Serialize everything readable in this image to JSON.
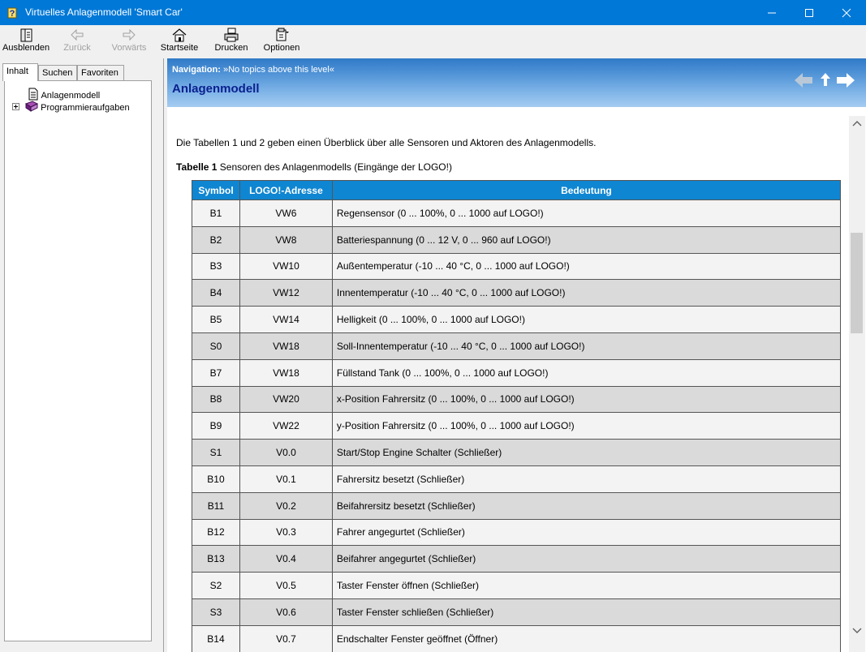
{
  "window": {
    "title": "Virtuelles Anlagenmodell 'Smart Car'",
    "app_icon": "help-question-icon",
    "controls": [
      "minimize-icon",
      "maximize-icon",
      "close-icon"
    ]
  },
  "toolbar": {
    "hide_label": "Ausblenden",
    "back_label": "Zurück",
    "forward_label": "Vorwärts",
    "home_label": "Startseite",
    "print_label": "Drucken",
    "options_label": "Optionen"
  },
  "tabs": {
    "contents": "Inhalt",
    "search": "Suchen",
    "favorites": "Favoriten"
  },
  "tree": [
    {
      "label": "Anlagenmodell",
      "icon": "page-icon"
    },
    {
      "label": "Programmieraufgaben",
      "icon": "book-icon",
      "expand": "+"
    }
  ],
  "content": {
    "nav_label": "Navigation:",
    "nav_text": "»No topics above this level«",
    "title": "Anlagenmodell",
    "intro": "Die Tabellen 1 und 2 geben einen Überblick über alle Sensoren und Aktoren des Anlagenmodells.",
    "caption_bold": "Tabelle 1",
    "caption_text": " Sensoren des Anlagenmodells (Eingänge der LOGO!)"
  },
  "table": {
    "headers": [
      "Symbol",
      "LOGO!-Adresse",
      "Bedeutung"
    ],
    "rows": [
      [
        "B1",
        "VW6",
        "Regensensor (0 ... 100%, 0 ... 1000 auf LOGO!)"
      ],
      [
        "B2",
        "VW8",
        "Batteriespannung (0 ... 12 V, 0 ... 960 auf LOGO!)"
      ],
      [
        "B3",
        "VW10",
        "Außentemperatur (-10 ... 40 °C, 0 ... 1000 auf LOGO!)"
      ],
      [
        "B4",
        "VW12",
        "Innentemperatur (-10 ... 40 °C, 0 ... 1000 auf LOGO!)"
      ],
      [
        "B5",
        "VW14",
        "Helligkeit (0 ... 100%, 0 ... 1000 auf LOGO!)"
      ],
      [
        "S0",
        "VW18",
        "Soll-Innentemperatur (-10 ... 40 °C, 0 ... 1000 auf LOGO!)"
      ],
      [
        "B7",
        "VW18",
        "Füllstand Tank (0 ... 100%, 0 ... 1000 auf LOGO!)"
      ],
      [
        "B8",
        "VW20",
        "x-Position Fahrersitz (0 ... 100%, 0 ... 1000 auf LOGO!)"
      ],
      [
        "B9",
        "VW22",
        "y-Position Fahrersitz (0 ... 100%, 0 ... 1000 auf LOGO!)"
      ],
      [
        "S1",
        "V0.0",
        "Start/Stop Engine Schalter (Schließer)"
      ],
      [
        "B10",
        "V0.1",
        "Fahrersitz besetzt (Schließer)"
      ],
      [
        "B11",
        "V0.2",
        "Beifahrersitz besetzt (Schließer)"
      ],
      [
        "B12",
        "V0.3",
        "Fahrer angegurtet (Schließer)"
      ],
      [
        "B13",
        "V0.4",
        "Beifahrer angegurtet (Schließer)"
      ],
      [
        "S2",
        "V0.5",
        "Taster Fenster öffnen (Schließer)"
      ],
      [
        "S3",
        "V0.6",
        "Taster Fenster schließen (Schließer)"
      ],
      [
        "B14",
        "V0.7",
        "Endschalter Fenster geöffnet (Öffner)"
      ]
    ]
  },
  "colors": {
    "titlebar": "#0078d7",
    "table_header": "#0f86d1",
    "title_text": "#0a1f8f"
  }
}
